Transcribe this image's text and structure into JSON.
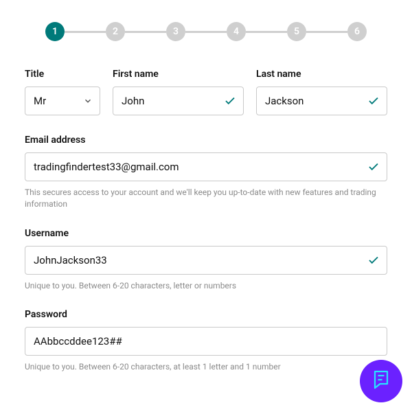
{
  "stepper": {
    "current": 1,
    "steps": [
      "1",
      "2",
      "3",
      "4",
      "5",
      "6"
    ]
  },
  "fields": {
    "title": {
      "label": "Title",
      "value": "Mr"
    },
    "first_name": {
      "label": "First name",
      "value": "John"
    },
    "last_name": {
      "label": "Last name",
      "value": "Jackson"
    },
    "email": {
      "label": "Email address",
      "value": "tradingfindertest33@gmail.com",
      "helper": "This secures access to your account and we'll keep you up-to-date with new features and trading information"
    },
    "username": {
      "label": "Username",
      "value": "JohnJackson33",
      "helper": "Unique to you. Between 6-20 characters, letter or numbers"
    },
    "password": {
      "label": "Password",
      "value": "AAbbccddee123##",
      "helper": "Unique to you. Between 6-20 characters, at least 1 letter and 1 number"
    }
  },
  "colors": {
    "accent": "#007a7a",
    "fab": "#6b21ff",
    "fab_icon": "#26e4ff"
  }
}
